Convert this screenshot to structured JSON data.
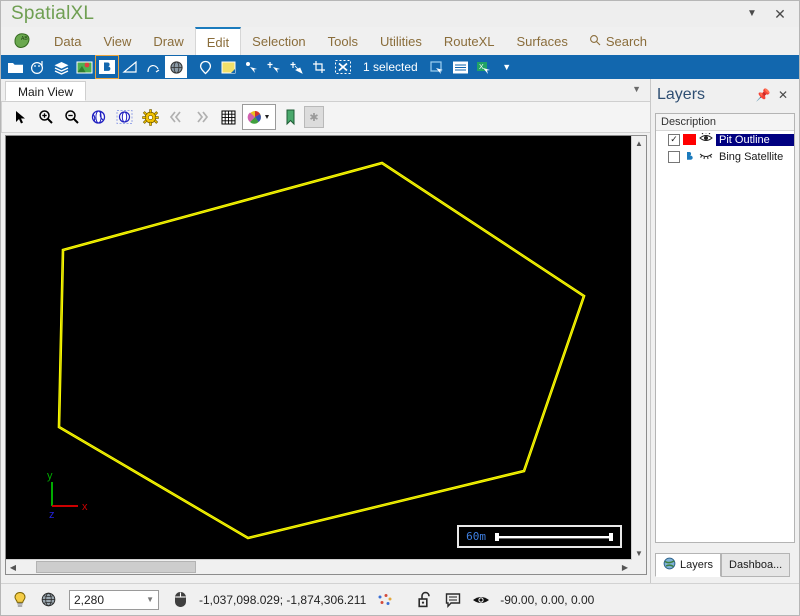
{
  "window": {
    "app_title": "SpatialXL",
    "caret_icon": "chevron-down-icon",
    "close_icon": "close-icon"
  },
  "menubar": {
    "logo_icon": "globe-ab-icon",
    "items": [
      {
        "label": "Data",
        "active": false
      },
      {
        "label": "View",
        "active": false
      },
      {
        "label": "Draw",
        "active": false
      },
      {
        "label": "Edit",
        "active": true
      },
      {
        "label": "Selection",
        "active": false
      },
      {
        "label": "Tools",
        "active": false
      },
      {
        "label": "Utilities",
        "active": false
      },
      {
        "label": "RouteXL",
        "active": false
      },
      {
        "label": "Surfaces",
        "active": false
      }
    ],
    "search_label": "Search",
    "search_icon": "search-icon"
  },
  "ribbon": {
    "status_text": "1 selected",
    "overflow_icon": "chevron-down-icon",
    "icons": [
      "open-folder-icon",
      "palette-pin-icon",
      "layers-stack-icon",
      "map-pin-image-icon",
      "bing-maps-icon",
      "measure-angle-icon",
      "snap-vertex-icon",
      "globe-wire-icon",
      "location-pin-icon",
      "note-window-icon",
      "select-point-icon",
      "move-vertex-icon",
      "insert-vertex-icon",
      "crop-select-icon",
      "clear-selection-icon",
      "copy-selection-icon",
      "table-view-icon",
      "excel-export-icon"
    ]
  },
  "view": {
    "tab_label": "Main View",
    "tab_overflow_icon": "chevron-down-icon",
    "tools": [
      "arrow-pointer-icon",
      "zoom-in-icon",
      "zoom-out-icon",
      "zoom-extents-icon",
      "zoom-selected-icon",
      "view-settings-icon",
      "previous-view-icon",
      "next-view-icon",
      "grid-icon",
      "color-legend-icon",
      "bookmark-icon",
      "favorite-icon"
    ],
    "scalebar_label": "60m",
    "axes": {
      "x": "x",
      "y": "y",
      "z": "z"
    },
    "scroll_up_icon": "chevron-up-icon",
    "scroll_down_icon": "chevron-down-icon",
    "scroll_left_icon": "chevron-left-icon",
    "scroll_right_icon": "chevron-right-icon"
  },
  "map": {
    "background_color": "#000000",
    "polygon_color": "#ffff00",
    "polygon_points": "381,162 583,295 523,470 247,537 58,426 62,249",
    "axis_x_color": "#cc0000",
    "axis_y_color": "#00aa00",
    "axis_z_color": "#0000dd"
  },
  "layers_panel": {
    "title": "Layers",
    "pin_icon": "pin-icon",
    "close_icon": "close-icon",
    "column_header": "Description",
    "rows": [
      {
        "name": "Pit Outline",
        "checked": true,
        "selected": true,
        "swatch": "#ff0000",
        "visibility_icon": "eye-open-icon"
      },
      {
        "name": "Bing Satellite",
        "checked": false,
        "selected": false,
        "swatch": "#1b7bbd",
        "visibility_icon": "eye-closed-icon"
      }
    ],
    "tabs": [
      {
        "label": "Layers",
        "icon": "globe-icon",
        "active": true
      },
      {
        "label": "Dashboa...",
        "icon": "",
        "active": false
      }
    ]
  },
  "statusbar": {
    "bulb_icon": "lightbulb-icon",
    "globe_icon": "globe-wire-icon",
    "scale_value": "2,280",
    "scale_caret_icon": "chevron-down-icon",
    "mouse_icon": "mouse-icon",
    "coordinates": "-1,037,098.029; -1,874,306.211",
    "points_icon": "scatter-points-icon",
    "lock_icon": "unlock-icon",
    "message_icon": "message-icon",
    "eye_icon": "eye-open-icon",
    "orientation": "-90.00, 0.00, 0.00"
  }
}
